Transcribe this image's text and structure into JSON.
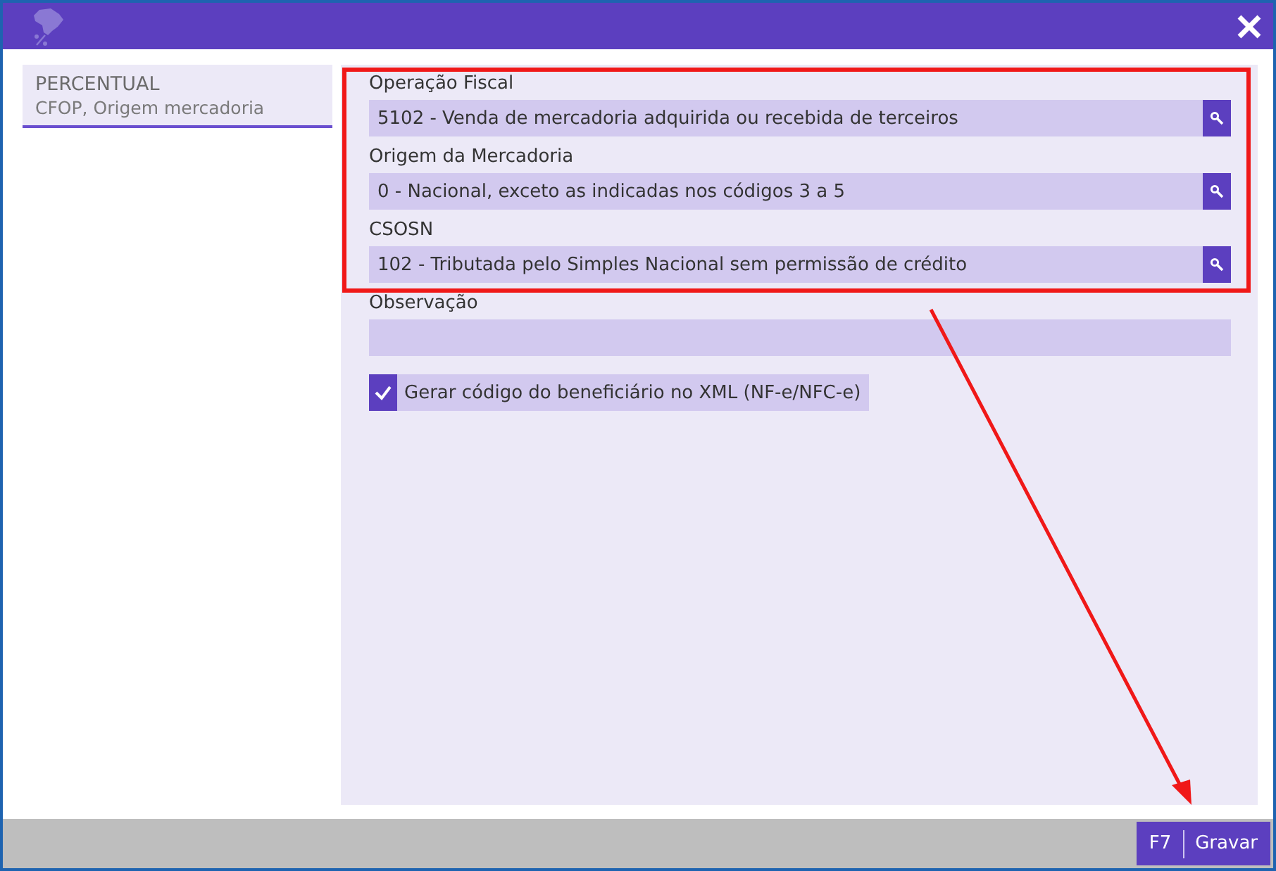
{
  "sidebar": {
    "items": [
      {
        "title": "PERCENTUAL",
        "subtitle": "CFOP, Origem mercadoria",
        "selected": true
      }
    ]
  },
  "fields": [
    {
      "kind": "lookup",
      "label": "Operação Fiscal",
      "value": "5102 - Venda de mercadoria adquirida ou recebida de terceiros"
    },
    {
      "kind": "lookup",
      "label": "Origem da Mercadoria",
      "value": "0 - Nacional, exceto as indicadas nos códigos 3 a 5"
    },
    {
      "kind": "lookup",
      "label": "CSOSN",
      "value": "102 - Tributada pelo Simples Nacional sem permissão de crédito"
    },
    {
      "kind": "text",
      "label": "Observação"
    }
  ],
  "checkbox": {
    "label": "Gerar código do beneficiário no XML (NF-e/NFC-e)",
    "checked": true
  },
  "footer": {
    "shortcut": "F7",
    "button": "Gravar"
  }
}
